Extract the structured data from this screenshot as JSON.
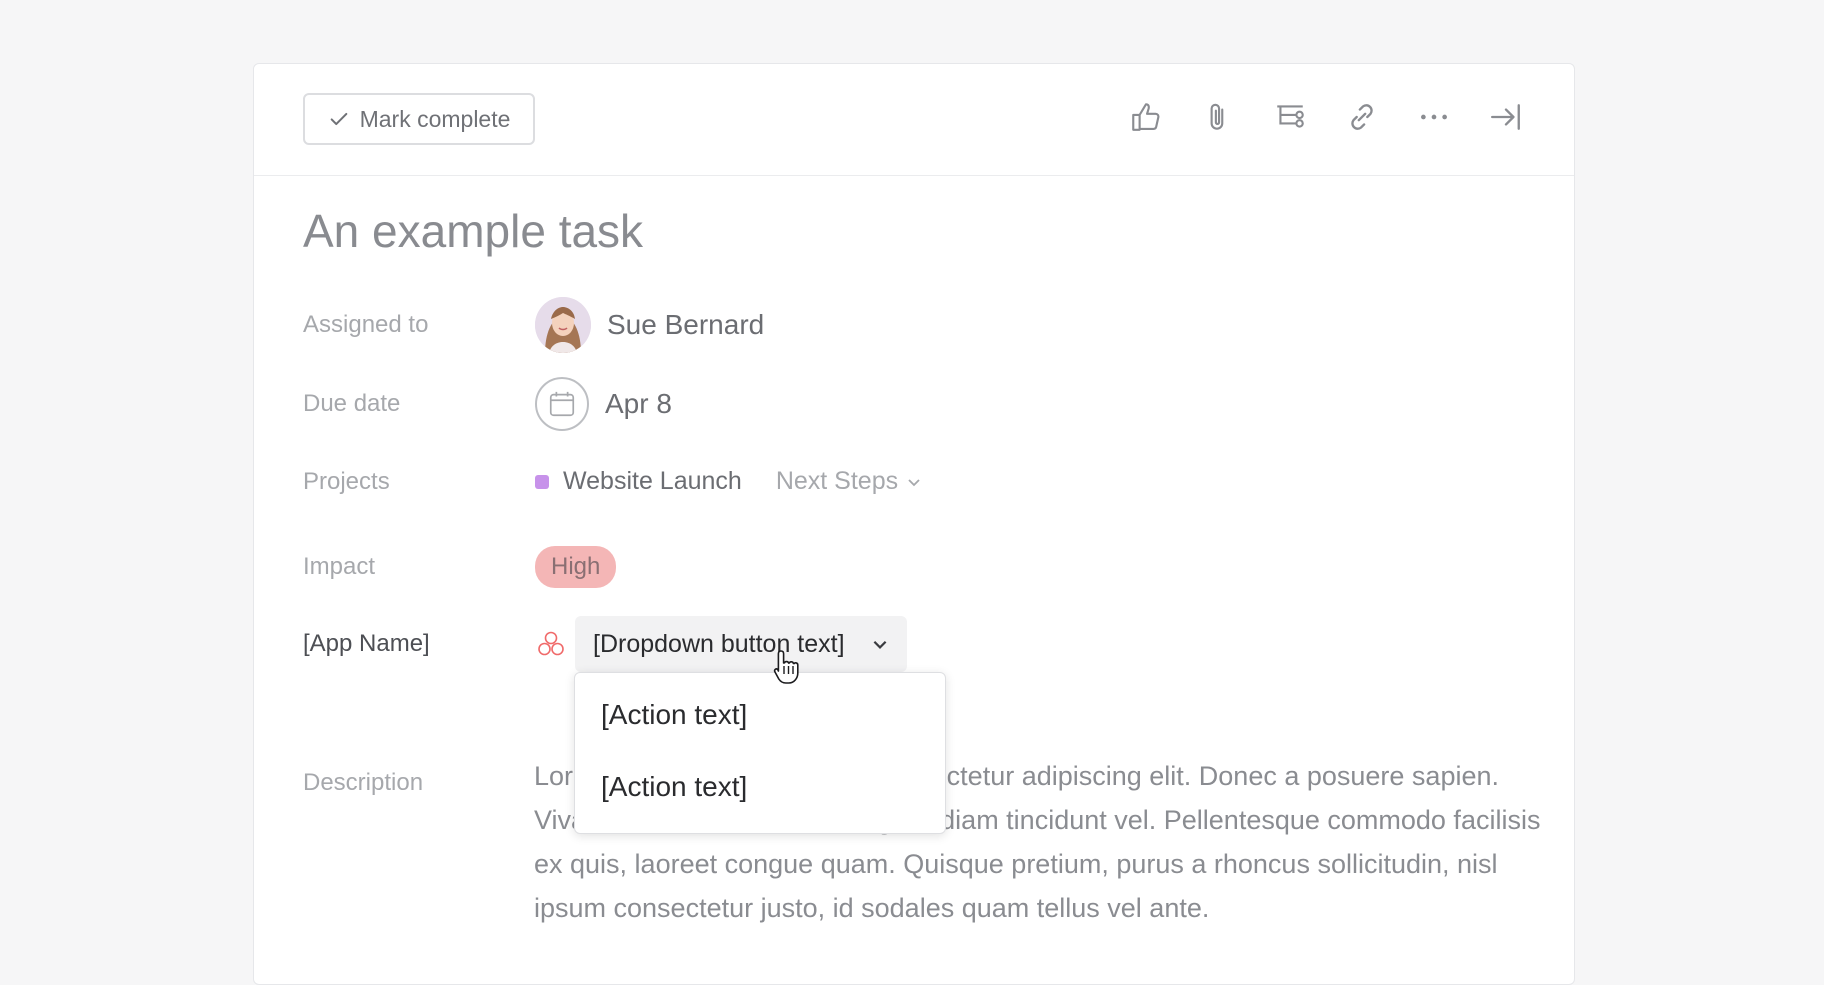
{
  "toolbar": {
    "mark_complete_label": "Mark complete",
    "icons": [
      "like-icon",
      "attachment-icon",
      "subtask-icon",
      "link-icon",
      "more-icon",
      "close-panel-icon"
    ]
  },
  "task": {
    "title": "An example task",
    "assigned_label": "Assigned to",
    "assignee_name": "Sue Bernard",
    "due_label": "Due date",
    "due_value": "Apr 8",
    "projects_label": "Projects",
    "project_name": "Website Launch",
    "project_color": "#c792ea",
    "section_name": "Next Steps",
    "impact_label": "Impact",
    "impact_value": "High",
    "impact_color": "#f4b6b6",
    "app_label": "[App Name]",
    "dropdown_text": "[Dropdown button text]",
    "description_label": "Description",
    "description_text": "Lorem ipsum dolor sit amet, consectetur adipiscing elit. Donec a posuere sapien. Vivamus at orci libero, vel sagittis diam tincidunt vel. Pellentesque commodo facilisis ex quis, laoreet congue quam. Quisque pretium, purus a rhoncus sollicitudin, nisl ipsum consectetur justo, id sodales quam tellus vel ante."
  },
  "menu": {
    "items": [
      "[Action text]",
      "[Action text]"
    ]
  }
}
